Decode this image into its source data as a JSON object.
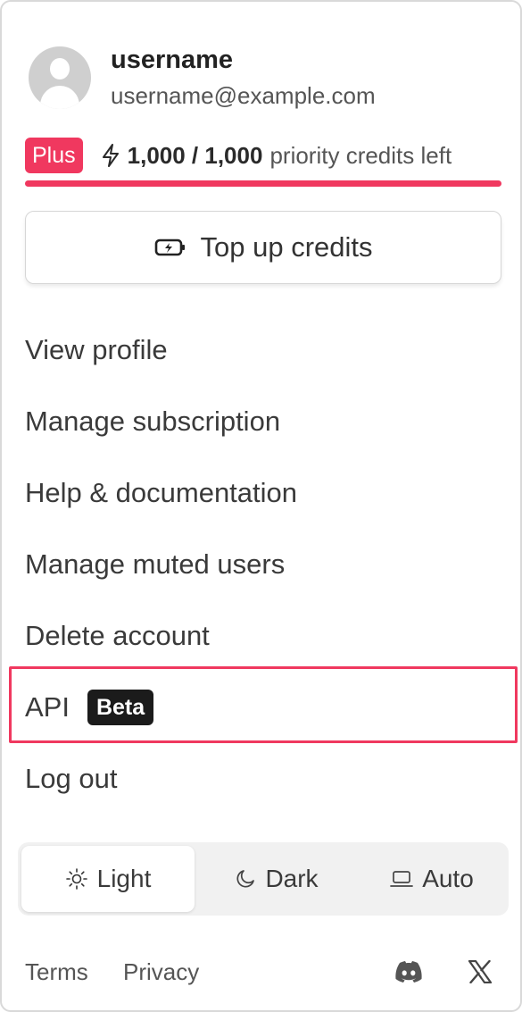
{
  "user": {
    "username": "username",
    "email": "username@example.com"
  },
  "plan": {
    "badge": "Plus",
    "credits": "1,000 / 1,000",
    "credits_label": "priority credits left",
    "credits_fraction": 1.0
  },
  "topup": {
    "label": "Top up credits",
    "icon": "battery-charging-icon"
  },
  "menu": [
    {
      "label": "View profile"
    },
    {
      "label": "Manage subscription"
    },
    {
      "label": "Help & documentation"
    },
    {
      "label": "Manage muted users"
    },
    {
      "label": "Delete account"
    },
    {
      "label": "API",
      "badge": "Beta"
    },
    {
      "label": "Log out"
    }
  ],
  "theme": {
    "options": [
      {
        "label": "Light",
        "icon": "sun-icon"
      },
      {
        "label": "Dark",
        "icon": "moon-icon"
      },
      {
        "label": "Auto",
        "icon": "laptop-icon"
      }
    ],
    "selected": "Light"
  },
  "footer": {
    "terms": "Terms",
    "privacy": "Privacy",
    "social": [
      "discord-icon",
      "x-icon"
    ]
  },
  "colors": {
    "accent": "#f0385f",
    "beta_badge": "#1b1b1b"
  }
}
